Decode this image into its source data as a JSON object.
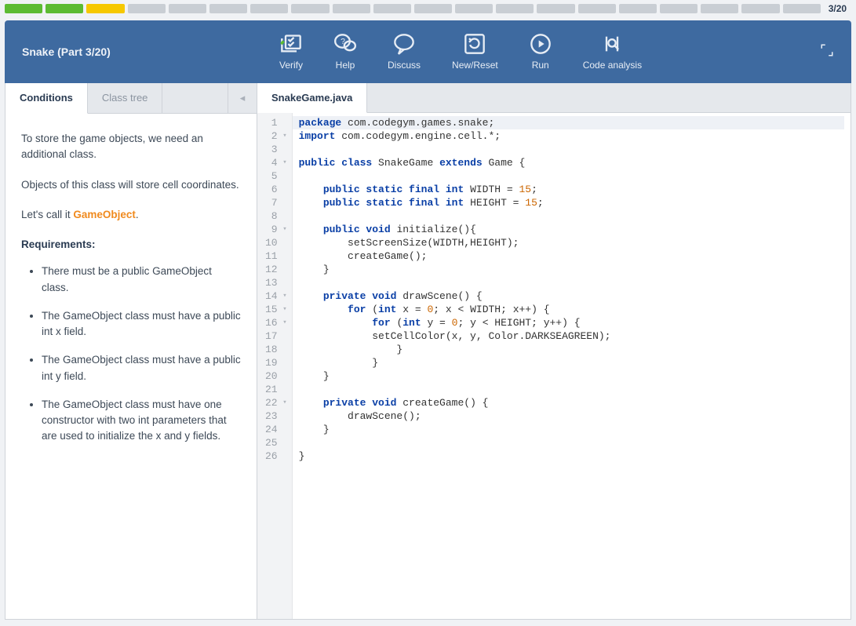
{
  "progress": {
    "total_segments": 20,
    "states": [
      "green",
      "green",
      "yellow",
      "gray",
      "gray",
      "gray",
      "gray",
      "gray",
      "gray",
      "gray",
      "gray",
      "gray",
      "gray",
      "gray",
      "gray",
      "gray",
      "gray",
      "gray",
      "gray",
      "gray"
    ],
    "label": "3/20"
  },
  "header": {
    "title": "Snake (Part 3/20)",
    "actions": {
      "verify": "Verify",
      "help": "Help",
      "discuss": "Discuss",
      "reset": "New/Reset",
      "run": "Run",
      "analysis": "Code analysis"
    }
  },
  "left_tabs": {
    "conditions": "Conditions",
    "classtree": "Class tree"
  },
  "conditions": {
    "p1": "To store the game objects, we need an additional class.",
    "p2": "Objects of this class will store cell coordinates.",
    "p3_prefix": "Let's call it ",
    "p3_go": "GameObject",
    "p3_suffix": ".",
    "req_h": "Requirements:",
    "reqs": [
      "There must be a public GameObject class.",
      "The GameObject class must have a public int x field.",
      "The GameObject class must have a public int y field.",
      "The GameObject class must have one constructor with two int parameters that are used to initialize the x and y fields."
    ]
  },
  "editor": {
    "filename": "SnakeGame.java",
    "lines": [
      {
        "n": 1,
        "fold": "",
        "hl": true,
        "tokens": [
          [
            "kw",
            "package"
          ],
          [
            "pkg",
            " com.codegym.games.snake;"
          ]
        ]
      },
      {
        "n": 2,
        "fold": "▾",
        "hl": false,
        "tokens": [
          [
            "kw",
            "import"
          ],
          [
            "pkg",
            " com.codegym.engine.cell.*;"
          ]
        ]
      },
      {
        "n": 3,
        "fold": "",
        "hl": false,
        "tokens": []
      },
      {
        "n": 4,
        "fold": "▾",
        "hl": false,
        "tokens": [
          [
            "kw",
            "public class"
          ],
          [
            "",
            " SnakeGame "
          ],
          [
            "kw",
            "extends"
          ],
          [
            "",
            " Game {"
          ]
        ]
      },
      {
        "n": 5,
        "fold": "",
        "hl": false,
        "tokens": []
      },
      {
        "n": 6,
        "fold": "",
        "hl": false,
        "tokens": [
          [
            "",
            "    "
          ],
          [
            "kw",
            "public static final int"
          ],
          [
            "",
            " WIDTH = "
          ],
          [
            "num",
            "15"
          ],
          [
            "",
            ";"
          ]
        ]
      },
      {
        "n": 7,
        "fold": "",
        "hl": false,
        "tokens": [
          [
            "",
            "    "
          ],
          [
            "kw",
            "public static final int"
          ],
          [
            "",
            " HEIGHT = "
          ],
          [
            "num",
            "15"
          ],
          [
            "",
            ";"
          ]
        ]
      },
      {
        "n": 8,
        "fold": "",
        "hl": false,
        "tokens": []
      },
      {
        "n": 9,
        "fold": "▾",
        "hl": false,
        "tokens": [
          [
            "",
            "    "
          ],
          [
            "kw",
            "public void"
          ],
          [
            "",
            " initialize(){"
          ]
        ]
      },
      {
        "n": 10,
        "fold": "",
        "hl": false,
        "tokens": [
          [
            "",
            "        setScreenSize(WIDTH,HEIGHT);"
          ]
        ]
      },
      {
        "n": 11,
        "fold": "",
        "hl": false,
        "tokens": [
          [
            "",
            "        createGame();"
          ]
        ]
      },
      {
        "n": 12,
        "fold": "",
        "hl": false,
        "tokens": [
          [
            "",
            "    }"
          ]
        ]
      },
      {
        "n": 13,
        "fold": "",
        "hl": false,
        "tokens": []
      },
      {
        "n": 14,
        "fold": "▾",
        "hl": false,
        "tokens": [
          [
            "",
            "    "
          ],
          [
            "kw",
            "private void"
          ],
          [
            "",
            " drawScene() {"
          ]
        ]
      },
      {
        "n": 15,
        "fold": "▾",
        "hl": false,
        "tokens": [
          [
            "",
            "        "
          ],
          [
            "kw",
            "for"
          ],
          [
            "",
            " ("
          ],
          [
            "kw",
            "int"
          ],
          [
            "",
            " x = "
          ],
          [
            "num",
            "0"
          ],
          [
            "",
            "; x < WIDTH; x++) {"
          ]
        ]
      },
      {
        "n": 16,
        "fold": "▾",
        "hl": false,
        "tokens": [
          [
            "",
            "            "
          ],
          [
            "kw",
            "for"
          ],
          [
            "",
            " ("
          ],
          [
            "kw",
            "int"
          ],
          [
            "",
            " y = "
          ],
          [
            "num",
            "0"
          ],
          [
            "",
            "; y < HEIGHT; y++) {"
          ]
        ]
      },
      {
        "n": 17,
        "fold": "",
        "hl": false,
        "tokens": [
          [
            "",
            "            setCellColor(x, y, Color.DARKSEAGREEN);"
          ]
        ]
      },
      {
        "n": 18,
        "fold": "",
        "hl": false,
        "tokens": [
          [
            "",
            "                }"
          ]
        ]
      },
      {
        "n": 19,
        "fold": "",
        "hl": false,
        "tokens": [
          [
            "",
            "            }"
          ]
        ]
      },
      {
        "n": 20,
        "fold": "",
        "hl": false,
        "tokens": [
          [
            "",
            "    }"
          ]
        ]
      },
      {
        "n": 21,
        "fold": "",
        "hl": false,
        "tokens": []
      },
      {
        "n": 22,
        "fold": "▾",
        "hl": false,
        "tokens": [
          [
            "",
            "    "
          ],
          [
            "kw",
            "private void"
          ],
          [
            "",
            " createGame() {"
          ]
        ]
      },
      {
        "n": 23,
        "fold": "",
        "hl": false,
        "tokens": [
          [
            "",
            "        drawScene();"
          ]
        ]
      },
      {
        "n": 24,
        "fold": "",
        "hl": false,
        "tokens": [
          [
            "",
            "    }"
          ]
        ]
      },
      {
        "n": 25,
        "fold": "",
        "hl": false,
        "tokens": []
      },
      {
        "n": 26,
        "fold": "",
        "hl": false,
        "tokens": [
          [
            "",
            "}"
          ]
        ]
      }
    ]
  }
}
